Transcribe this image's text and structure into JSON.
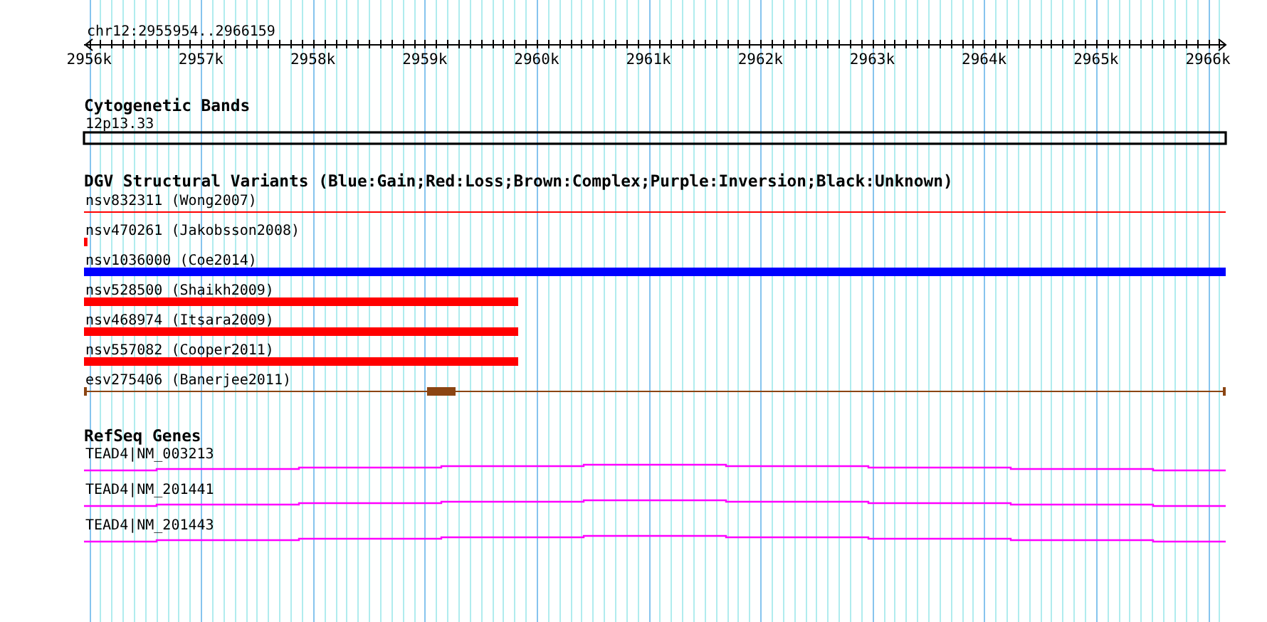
{
  "ruler": {
    "title": "chr12:2955954..2966159",
    "ticks": [
      "2956k",
      "2957k",
      "2958k",
      "2959k",
      "2960k",
      "2961k",
      "2962k",
      "2963k",
      "2964k",
      "2965k",
      "2966k"
    ]
  },
  "tracks": [
    {
      "kind": "band",
      "title": "Cytogenetic Bands",
      "features": [
        {
          "label": "12p13.33"
        }
      ]
    },
    {
      "kind": "variants",
      "title": "DGV Structural Variants (Blue:Gain;Red:Loss;Brown:Complex;Purple:Inversion;Black:Unknown)",
      "features": [
        {
          "label": "nsv832311 (Wong2007)",
          "kind": "thin",
          "color": "#ff0000"
        },
        {
          "label": "nsv470261 (Jakobsson2008)",
          "kind": "thick",
          "color": "#ff0000"
        },
        {
          "label": "nsv1036000 (Coe2014)",
          "kind": "thick",
          "color": "#0000ff"
        },
        {
          "label": "nsv528500 (Shaikh2009)",
          "kind": "thick",
          "color": "#ff0000"
        },
        {
          "label": "nsv468974 (Itsara2009)",
          "kind": "thick",
          "color": "#ff0000"
        },
        {
          "label": "nsv557082 (Cooper2011)",
          "kind": "thick",
          "color": "#ff0000"
        },
        {
          "label": "esv275406 (Banerjee2011)",
          "kind": "gapped",
          "color": "#8b4513"
        }
      ]
    },
    {
      "kind": "genes",
      "title": "RefSeq Genes",
      "features": [
        {
          "label": "TEAD4|NM_003213"
        },
        {
          "label": "TEAD4|NM_201441"
        },
        {
          "label": "TEAD4|NM_201443"
        }
      ]
    }
  ]
}
